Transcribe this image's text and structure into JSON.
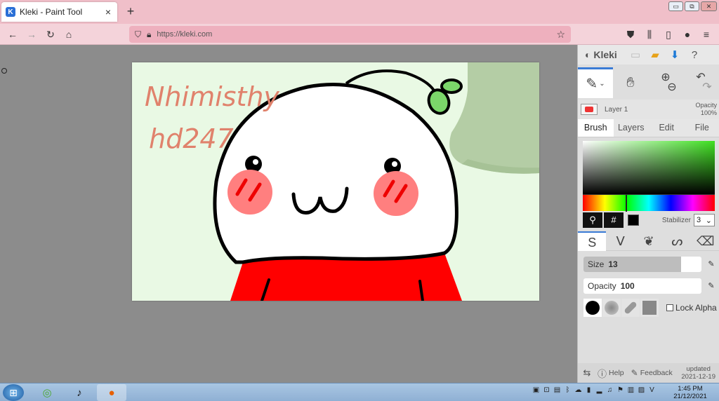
{
  "browser": {
    "tab_title": "Kleki - Paint Tool",
    "tab_close": "×",
    "new_tab": "+",
    "url": "https://kleki.com",
    "win_min": "▭",
    "win_restore": "⧉",
    "win_close": "✕"
  },
  "canvas": {
    "signature_line1": "Nhimisthy",
    "signature_line2": "hd247"
  },
  "panel": {
    "logo": "Kleki",
    "layer_name": "Layer 1",
    "layer_opacity_label": "Opacity",
    "layer_opacity_value": "100%",
    "tabs": [
      "Brush",
      "Layers",
      "Edit",
      "File"
    ],
    "picker_icon": "eyedropper-icon",
    "hex_button": "#",
    "stabilizer_label": "Stabilizer",
    "stabilizer_value": "3",
    "size_label": "Size",
    "size_value": "13",
    "size_level": 0.83,
    "opacity_label": "Opacity",
    "opacity_value": "100",
    "lock_alpha": "Lock Alpha",
    "help": "Help",
    "feedback": "Feedback",
    "updated_label": "updated",
    "updated_date": "2021-12-19",
    "current_color": "#000000"
  },
  "taskbar": {
    "time": "1:45 PM",
    "date": "21/12/2021"
  }
}
